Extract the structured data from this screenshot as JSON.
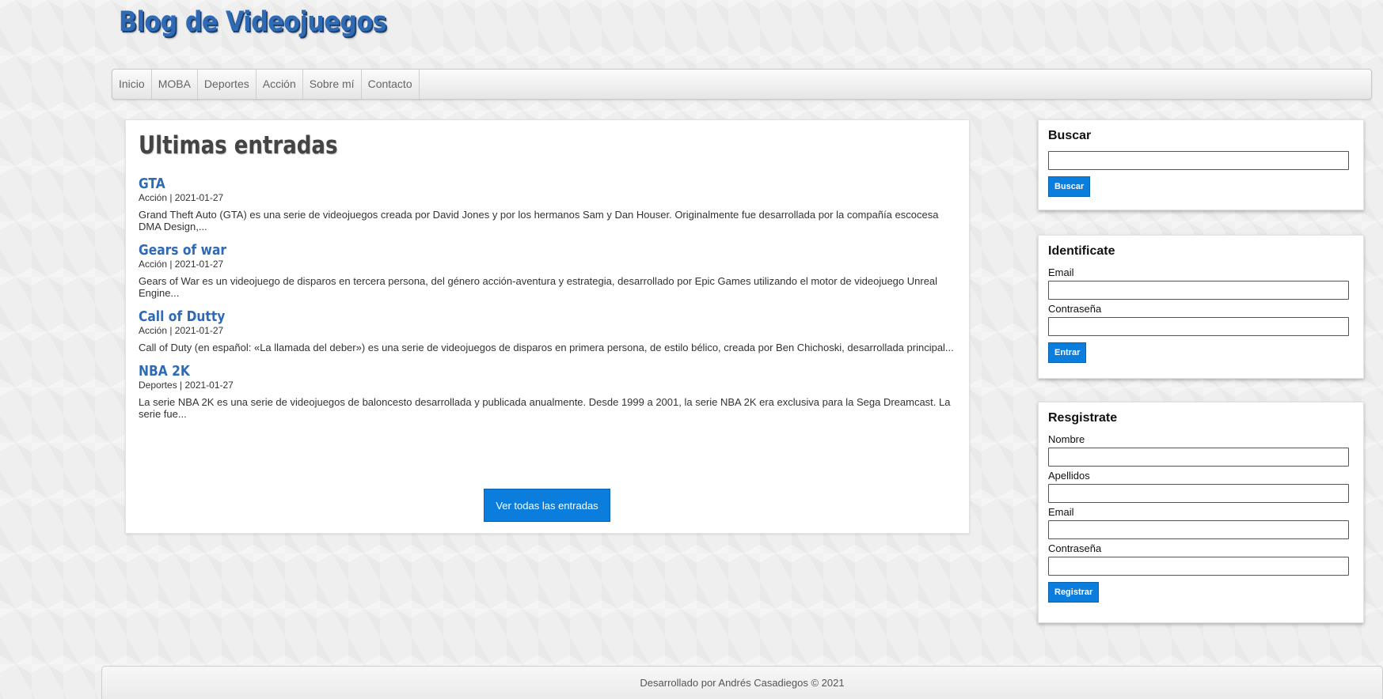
{
  "header": {
    "title": "Blog de Videojuegos"
  },
  "nav": {
    "items": [
      "Inicio",
      "MOBA",
      "Deportes",
      "Acción",
      "Sobre mí",
      "Contacto"
    ]
  },
  "main": {
    "title": "Ultimas entradas",
    "entries": [
      {
        "title": "GTA",
        "meta": "Acción | 2021-01-27",
        "excerpt": "Grand Theft Auto (GTA) es una serie de videojuegos creada por David Jones y por los hermanos Sam y Dan Houser. Originalmente fue desarrollada por la compañía escocesa DMA Design,..."
      },
      {
        "title": "Gears of war",
        "meta": "Acción | 2021-01-27",
        "excerpt": "Gears of War es un videojuego de disparos en tercera persona, del género acción-aventura y estrategia, desarrollado por Epic Games utilizando el motor de videojuego Unreal Engine..."
      },
      {
        "title": "Call of Dutty",
        "meta": "Acción | 2021-01-27",
        "excerpt": "Call of Duty (en español: «La llamada del deber») es una serie de videojuegos de disparos en primera persona, de estilo bélico, creada por Ben Chichoski, desarrollada principal..."
      },
      {
        "title": "NBA 2K",
        "meta": "Deportes | 2021-01-27",
        "excerpt": "La serie NBA 2K es una serie de videojuegos de baloncesto desarrollada y publicada anualmente. Desde 1999 a 2001, la serie NBA 2K era exclusiva para la Sega Dreamcast. La serie fue..."
      }
    ],
    "view_all_label": "Ver todas las entradas"
  },
  "search": {
    "title": "Buscar",
    "value": "",
    "button_label": "Buscar"
  },
  "login": {
    "title": "Identificate",
    "email_label": "Email",
    "password_label": "Contraseña",
    "button_label": "Entrar"
  },
  "register": {
    "title": "Resgistrate",
    "name_label": "Nombre",
    "surname_label": "Apellidos",
    "email_label": "Email",
    "password_label": "Contraseña",
    "button_label": "Registrar"
  },
  "footer": {
    "text": "Desarrollado por Andrés Casadiegos © 2021"
  },
  "colors": {
    "accent": "#0b7ddc",
    "title_blue": "#2f6bb5"
  }
}
